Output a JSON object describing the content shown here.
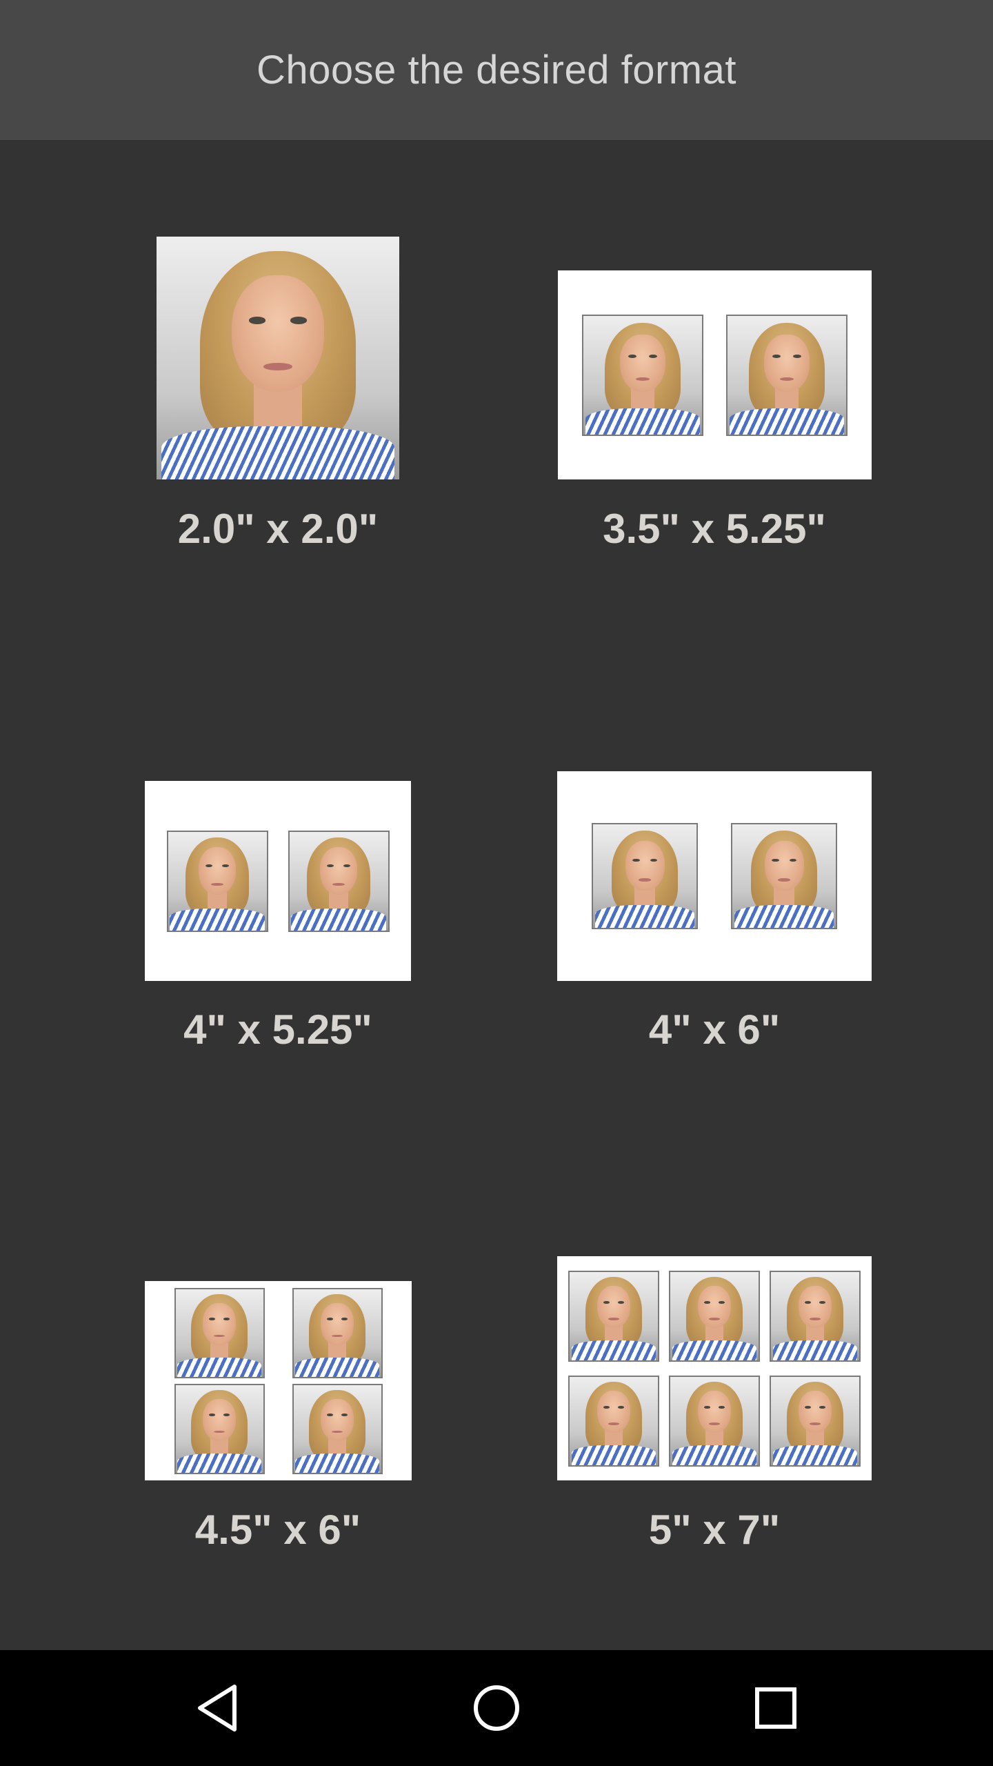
{
  "header": {
    "title": "Choose the desired format"
  },
  "formats": [
    {
      "label": "2.0\" x 2.0\"",
      "layout": "single"
    },
    {
      "label": "3.5\" x 5.25\"",
      "layout": "2-photo"
    },
    {
      "label": "4\" x 5.25\"",
      "layout": "2-photo"
    },
    {
      "label": "4\" x 6\"",
      "layout": "2-photo"
    },
    {
      "label": "4.5\" x 6\"",
      "layout": "4-photo"
    },
    {
      "label": "5\" x 7\"",
      "layout": "6-photo"
    }
  ],
  "navbar": {
    "icons": [
      "back-triangle-icon",
      "home-circle-icon",
      "recents-square-icon"
    ]
  },
  "colors": {
    "background": "#333333",
    "header": "#484848",
    "label": "#d8d5d0",
    "navbar": "#000000"
  }
}
